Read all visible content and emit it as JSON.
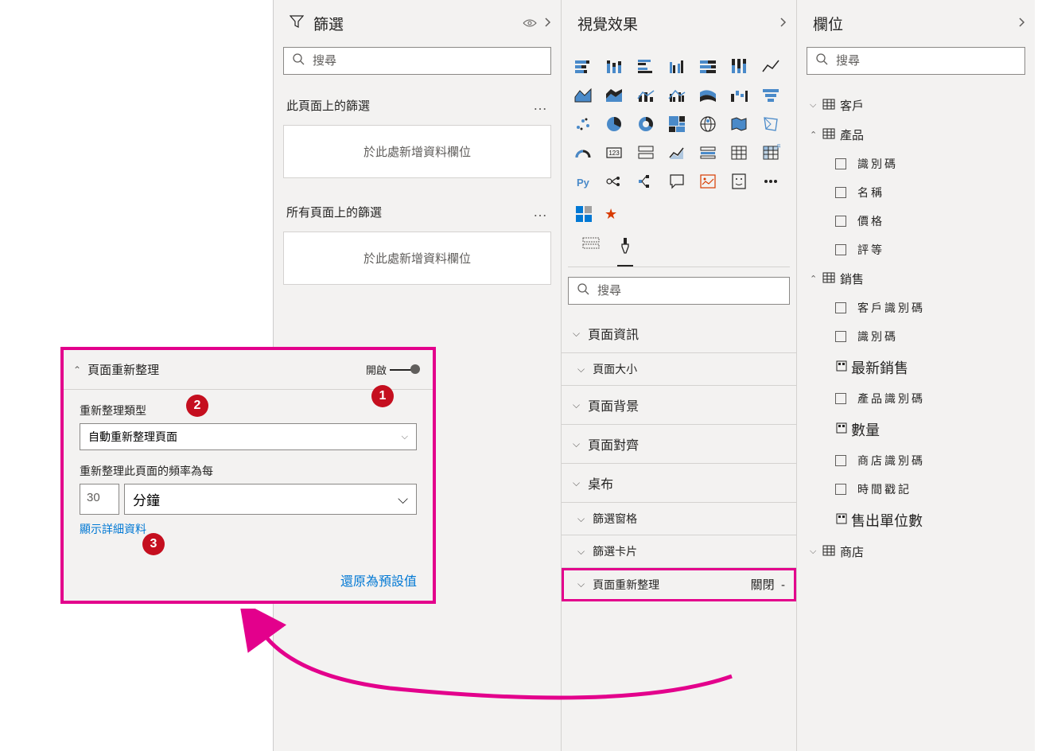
{
  "filters": {
    "title": "篩選",
    "search_placeholder": "搜尋",
    "this_page": "此頁面上的篩選",
    "add_field": "於此處新增資料欄位",
    "all_pages": "所有頁面上的篩選"
  },
  "visualizations": {
    "title": "視覺效果",
    "search_placeholder": "搜尋",
    "sections": {
      "page_info": "頁面資訊",
      "page_size": "頁面大小",
      "page_background": "頁面背景",
      "page_alignment": "頁面對齊",
      "wallpaper": "桌布",
      "filter_pane": "篩選窗格",
      "filter_card": "篩選卡片",
      "page_refresh": "頁面重新整理"
    },
    "page_refresh_state": "關閉",
    "page_refresh_dash": "-"
  },
  "fields": {
    "title": "欄位",
    "search_placeholder": "搜尋",
    "tables": {
      "customer": "客戶",
      "product": "產品",
      "sales": "銷售",
      "store": "商店"
    },
    "product_fields": {
      "id": "識別碼",
      "name": "名稱",
      "price": "價格",
      "rating": "評等"
    },
    "sales_fields": {
      "customer_id": "客戶識別碼",
      "id": "識別碼",
      "latest_sales": "最新銷售",
      "product_id": "產品識別碼",
      "quantity": "數量",
      "store_id": "商店識別碼",
      "timestamp": "時間戳記",
      "units_sold": "售出單位數"
    }
  },
  "callout": {
    "title": "頁面重新整理",
    "toggle_state": "開啟",
    "refresh_type_label": "重新整理類型",
    "refresh_type_value": "自動重新整理頁面",
    "interval_label": "重新整理此頁面的頻率為每",
    "interval_value": "30",
    "interval_unit": "分鐘",
    "show_details": "顯示詳細資料",
    "reset": "還原為預設值"
  },
  "badges": {
    "b1": "1",
    "b2": "2",
    "b3": "3"
  }
}
